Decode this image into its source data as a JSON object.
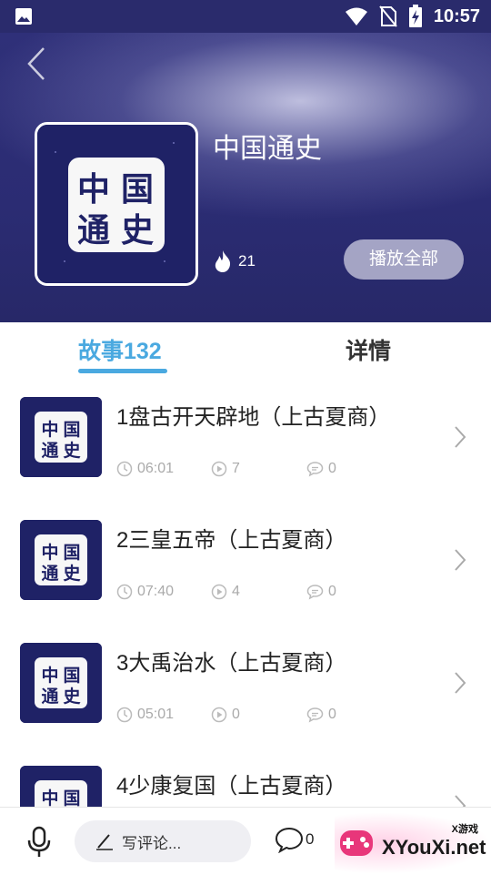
{
  "status_bar": {
    "time": "10:57"
  },
  "album": {
    "title": "中国通史",
    "cover_text": [
      "中",
      "国",
      "通",
      "史"
    ],
    "hot_count": "21",
    "play_all_label": "播放全部"
  },
  "tabs": [
    {
      "label": "故事132",
      "active": true
    },
    {
      "label": "详情",
      "active": false
    }
  ],
  "stories": [
    {
      "name": "1盘古开天辟地（上古夏商）",
      "duration": "06:01",
      "plays": "7",
      "comments": "0"
    },
    {
      "name": "2三皇五帝（上古夏商）",
      "duration": "07:40",
      "plays": "4",
      "comments": "0"
    },
    {
      "name": "3大禹治水（上古夏商）",
      "duration": "05:01",
      "plays": "0",
      "comments": "0"
    },
    {
      "name": "4少康复国（上古夏商）",
      "duration": "",
      "plays": "",
      "comments": ""
    }
  ],
  "bottom_bar": {
    "comment_placeholder": "写评论...",
    "comment_count": "0"
  },
  "watermark": {
    "small": "X游戏",
    "big": "XYouXi.net"
  },
  "colors": {
    "accent": "#4aa9e0",
    "header_bg": "#2b2c73",
    "cover_bg": "#1f2266"
  }
}
